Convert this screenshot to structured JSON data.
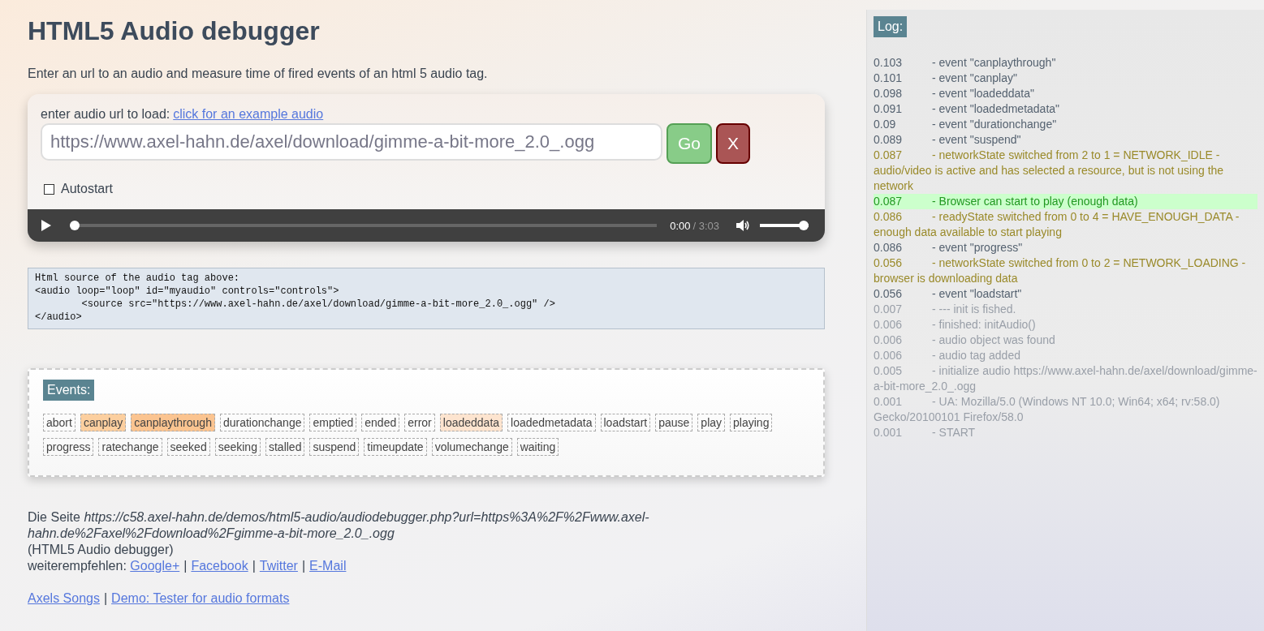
{
  "page": {
    "title": "HTML5 Audio debugger",
    "intro": "Enter an url to an audio and measure time of fired events of an html 5 audio tag."
  },
  "loader": {
    "label": "enter audio url to load:",
    "example_link": "click for an example audio",
    "url_field": {
      "value": "https://www.axel-hahn.de/axel/download/gimme-a-bit-more_2.0_.ogg"
    },
    "go_button": "Go",
    "clear_button": "X",
    "autostart": {
      "label": "Autostart",
      "checked": false
    }
  },
  "player": {
    "playing": false,
    "progress": {
      "level": 0
    },
    "current_time": "0:00",
    "duration": "/ 3:03",
    "volume": {
      "level": 1
    }
  },
  "source_code": [
    "Html source of the audio tag above:",
    "<audio loop=\"loop\" id=\"myaudio\" controls=\"controls\">",
    "        <source src=\"https://www.axel-hahn.de/axel/download/gimme-a-bit-more_2.0_.ogg\" />",
    "</audio>"
  ],
  "events": {
    "heading": "Events:",
    "items": [
      {
        "name": "abort"
      },
      {
        "name": "canplay",
        "color": "#fccf9f"
      },
      {
        "name": "canplaythrough",
        "color": "#fbc490"
      },
      {
        "name": "durationchange"
      },
      {
        "name": "emptied"
      },
      {
        "name": "ended"
      },
      {
        "name": "error"
      },
      {
        "name": "loadeddata",
        "color": "#fde4cf"
      },
      {
        "name": "loadedmetadata"
      },
      {
        "name": "loadstart"
      },
      {
        "name": "pause"
      },
      {
        "name": "play"
      },
      {
        "name": "playing"
      },
      {
        "name": "progress"
      },
      {
        "name": "ratechange"
      },
      {
        "name": "seeked"
      },
      {
        "name": "seeking"
      },
      {
        "name": "stalled"
      },
      {
        "name": "suspend"
      },
      {
        "name": "timeupdate"
      },
      {
        "name": "volumechange"
      },
      {
        "name": "waiting"
      }
    ]
  },
  "footer": {
    "page_line": "Die Seite *https://c58.axel-hahn.de/demos/html5-audio/audiodebugger.php?url=https%3A%2F%2Fwww.axel-hahn.de%2Faxel%2Fdownload%2Fgimme-a-bit-more_2.0_.ogg*",
    "page_name": "(HTML5 Audio debugger)",
    "share_label": "weiterempfehlen:",
    "share_links": [
      "Google+",
      "Facebook",
      "Twitter",
      "E-Mail"
    ],
    "separator": "|",
    "bottom_links": [
      "Axels Songs",
      "Demo: Tester for audio formats"
    ]
  },
  "log": {
    "heading": "Log:",
    "entries": [
      {
        "time": "0.103",
        "message": "- event \"canplaythrough\"",
        "kind": "event"
      },
      {
        "time": "0.101",
        "message": "- event \"canplay\"",
        "kind": "event"
      },
      {
        "time": "0.098",
        "message": "- event \"loadeddata\"",
        "kind": "event"
      },
      {
        "time": "0.091",
        "message": "- event \"loadedmetadata\"",
        "kind": "event"
      },
      {
        "time": "0.09",
        "message": "- event \"durationchange\"",
        "kind": "event"
      },
      {
        "time": "0.089",
        "message": "- event \"suspend\"",
        "kind": "event"
      },
      {
        "time": "0.087",
        "message": "- networkState switched from 2 to 1 = NETWORK_IDLE - audio/video is active and has selected a resource, but is not using the network",
        "kind": "state"
      },
      {
        "time": "0.087",
        "message": "- Browser can start to play (enough data)",
        "kind": "success"
      },
      {
        "time": "0.086",
        "message": "- readyState switched from 0 to 4 = HAVE_ENOUGH_DATA - enough data available to start playing",
        "kind": "state"
      },
      {
        "time": "0.086",
        "message": "- event \"progress\"",
        "kind": "event"
      },
      {
        "time": "0.056",
        "message": "- networkState switched from 0 to 2 = NETWORK_LOADING - browser is downloading data",
        "kind": "state"
      },
      {
        "time": "0.056",
        "message": "- event \"loadstart\"",
        "kind": "event"
      },
      {
        "time": "0.007",
        "message": "- --- init is fished.",
        "kind": "info"
      },
      {
        "time": "0.006",
        "message": "- finished: initAudio()",
        "kind": "info"
      },
      {
        "time": "0.006",
        "message": "- audio object was found",
        "kind": "info"
      },
      {
        "time": "0.006",
        "message": "- audio tag added",
        "kind": "info"
      },
      {
        "time": "0.005",
        "message": "- initialize audio https://www.axel-hahn.de/axel/download/gimme-a-bit-more_2.0_.ogg",
        "kind": "info"
      },
      {
        "time": "0.001",
        "message": "- UA: Mozilla/5.0 (Windows NT 10.0; Win64; x64; rv:58.0) Gecko/20100101 Firefox/58.0",
        "kind": "info"
      },
      {
        "time": "0.001",
        "message": "- START",
        "kind": "info"
      }
    ]
  }
}
